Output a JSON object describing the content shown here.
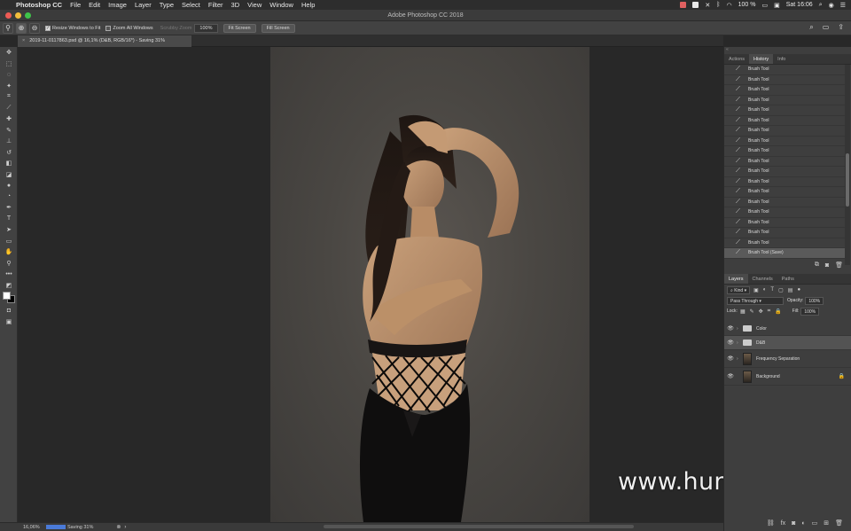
{
  "menubar": {
    "app": "Photoshop CC",
    "items": [
      "File",
      "Edit",
      "Image",
      "Layer",
      "Type",
      "Select",
      "Filter",
      "3D",
      "View",
      "Window",
      "Help"
    ],
    "battery": "100 %",
    "clock": "Sat 16:06"
  },
  "window": {
    "title": "Adobe Photoshop CC 2018"
  },
  "options": {
    "resize_label": "Resize Windows to Fit",
    "zoom_all_label": "Zoom All Windows",
    "scrubby_label": "Scrubby Zoom",
    "zoom_value": "100%",
    "fit_label": "Fit Screen",
    "fill_label": "Fill Screen"
  },
  "document": {
    "tab_title": "2019-11-0117863.psd @ 16,1% (D&B, RGB/16*) - Saving 31%"
  },
  "status": {
    "zoom": "16,06%",
    "progress_pct": 31,
    "text": "Saving 31%"
  },
  "watermark": "www.hunls.com",
  "history": {
    "tabs": [
      "Actions",
      "History",
      "Info"
    ],
    "active_tab": "History",
    "items": [
      "Brush Tool",
      "Brush Tool",
      "Brush Tool",
      "Brush Tool",
      "Brush Tool",
      "Brush Tool",
      "Brush Tool",
      "Brush Tool",
      "Brush Tool",
      "Brush Tool",
      "Brush Tool",
      "Brush Tool",
      "Brush Tool",
      "Brush Tool",
      "Brush Tool",
      "Brush Tool",
      "Brush Tool",
      "Brush Tool",
      "Brush Tool (Save)"
    ]
  },
  "layers": {
    "tabs": [
      "Layers",
      "Channels",
      "Paths"
    ],
    "active_tab": "Layers",
    "kind": "Kind",
    "blend": "Pass Through",
    "opacity_label": "Opacity:",
    "opacity": "100%",
    "lock_label": "Lock:",
    "fill_label": "Fill:",
    "fill": "100%",
    "items": [
      "Color",
      "D&B",
      "Frequency Separation",
      "Background"
    ]
  }
}
